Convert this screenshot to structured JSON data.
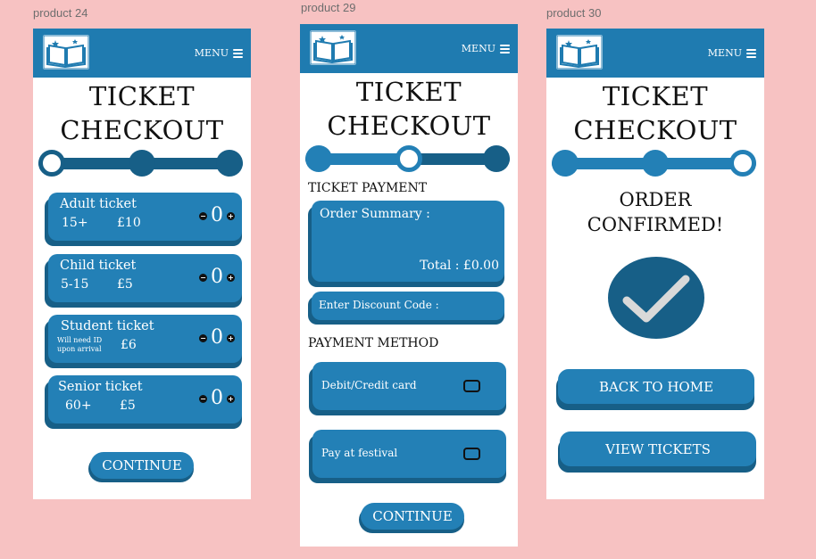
{
  "frames": [
    {
      "label": "product 24"
    },
    {
      "label": "product 29"
    },
    {
      "label": "product 30"
    }
  ],
  "header": {
    "menu_label": "MENU",
    "logo_icon": "open-book-icon",
    "menu_icon": "hamburger-icon"
  },
  "title": {
    "line1": "TICKET",
    "line2": "CHECKOUT"
  },
  "colors": {
    "background": "#f7c2c2",
    "primary": "#2380b6",
    "primary_dark": "#175f87",
    "topbar": "#1f7bb0"
  },
  "tickets": [
    {
      "name": "Adult ticket",
      "age": "15+",
      "price": "£10",
      "qty": "0",
      "note": ""
    },
    {
      "name": "Child ticket",
      "age": "5-15",
      "price": "£5",
      "qty": "0",
      "note": ""
    },
    {
      "name": "Student ticket",
      "age": "",
      "price": "£6",
      "qty": "0",
      "note": "Will need ID upon arrival"
    },
    {
      "name": "Senior ticket",
      "age": "60+",
      "price": "£5",
      "qty": "0",
      "note": ""
    }
  ],
  "qty_controls": {
    "minus": "−",
    "plus": "+"
  },
  "continue_label": "CONTINUE",
  "payment": {
    "heading": "TICKET PAYMENT",
    "summary_label": "Order Summary :",
    "total_label": "Total : £0.00",
    "discount_label": "Enter Discount Code :",
    "method_heading": "PAYMENT METHOD",
    "options": [
      {
        "label": "Debit/Credit card",
        "checked": false
      },
      {
        "label": "Pay at festival",
        "checked": false
      }
    ]
  },
  "confirmation": {
    "line1": "ORDER",
    "line2": "CONFIRMED!",
    "check_icon": "checkmark-icon",
    "back_home_label": "BACK TO HOME",
    "view_tickets_label": "VIEW TICKETS"
  }
}
